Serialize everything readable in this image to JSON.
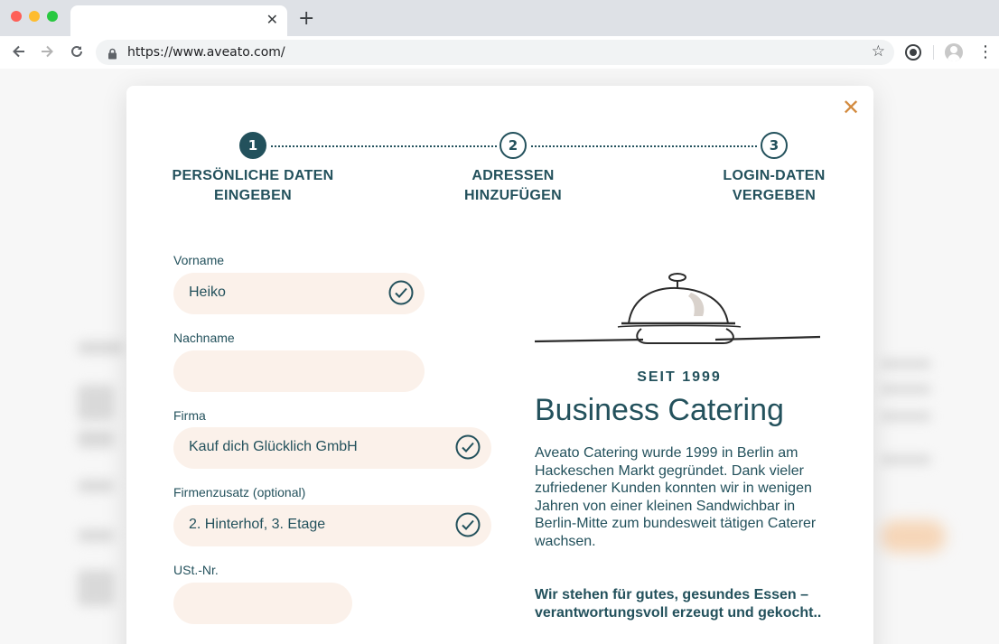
{
  "browser": {
    "url": "https://www.aveato.com/",
    "tab_close": "✕",
    "new_tab": "+"
  },
  "modal": {
    "close": "✕",
    "steps": [
      {
        "number": "1",
        "label_line1": "PERSÖNLICHE DATEN",
        "label_line2": "EINGEBEN",
        "active": true
      },
      {
        "number": "2",
        "label_line1": "ADRESSEN",
        "label_line2": "HINZUFÜGEN",
        "active": false
      },
      {
        "number": "3",
        "label_line1": "LOGIN-DATEN",
        "label_line2": "VERGEBEN",
        "active": false
      }
    ],
    "form": {
      "vorname": {
        "label": "Vorname",
        "value": "Heiko",
        "valid": true
      },
      "nachname": {
        "label": "Nachname",
        "value": "",
        "valid": false
      },
      "firma": {
        "label": "Firma",
        "value": "Kauf dich Glücklich GmbH",
        "valid": true
      },
      "firmenzusatz": {
        "label": "Firmenzusatz (optional)",
        "value": "2. Hinterhof, 3. Etage",
        "valid": true
      },
      "ust": {
        "label": "USt.-Nr.",
        "value": "",
        "valid": false
      }
    },
    "info": {
      "since": "SEIT 1999",
      "title": "Business Catering",
      "description": "Aveato Catering wurde 1999 in Berlin am Hackeschen Markt gegründet. Dank vieler zufriedener Kunden konnten wir in wenigen Jahren von einer kleinen Sandwichbar in Berlin-Mitte zum bundesweit tätigen Caterer wachsen.",
      "motto": "Wir stehen für gutes, gesundes Essen – verantwortungsvoll erzeugt und gekocht.."
    }
  },
  "colors": {
    "primary": "#23515c",
    "accent": "#d38b3f",
    "field_bg": "#fbf1ea"
  }
}
